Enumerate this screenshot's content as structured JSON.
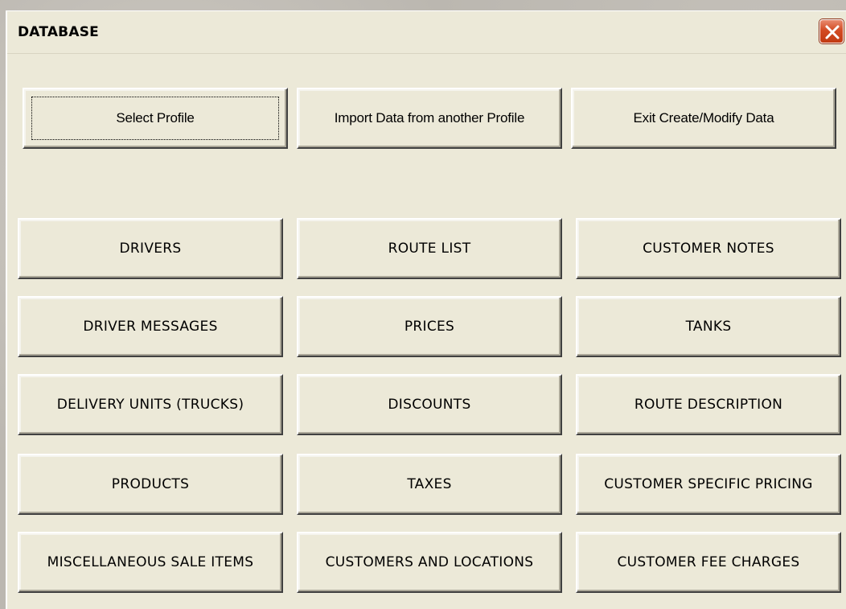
{
  "window": {
    "title": "DATABASE"
  },
  "top_buttons": [
    {
      "label": "Select Profile",
      "focused": true
    },
    {
      "label": "Import Data from another Profile"
    },
    {
      "label": "Exit Create/Modify Data"
    }
  ],
  "grid_buttons": [
    [
      "DRIVERS",
      "ROUTE LIST",
      "CUSTOMER NOTES"
    ],
    [
      "DRIVER MESSAGES",
      "PRICES",
      "TANKS"
    ],
    [
      "DELIVERY UNITS (TRUCKS)",
      "DISCOUNTS",
      "ROUTE DESCRIPTION"
    ],
    [
      "PRODUCTS",
      "TAXES",
      "CUSTOMER SPECIFIC PRICING"
    ],
    [
      "MISCELLANEOUS SALE ITEMS",
      "CUSTOMERS AND LOCATIONS",
      "CUSTOMER FEE CHARGES"
    ]
  ],
  "icons": {
    "close": "close-icon"
  }
}
